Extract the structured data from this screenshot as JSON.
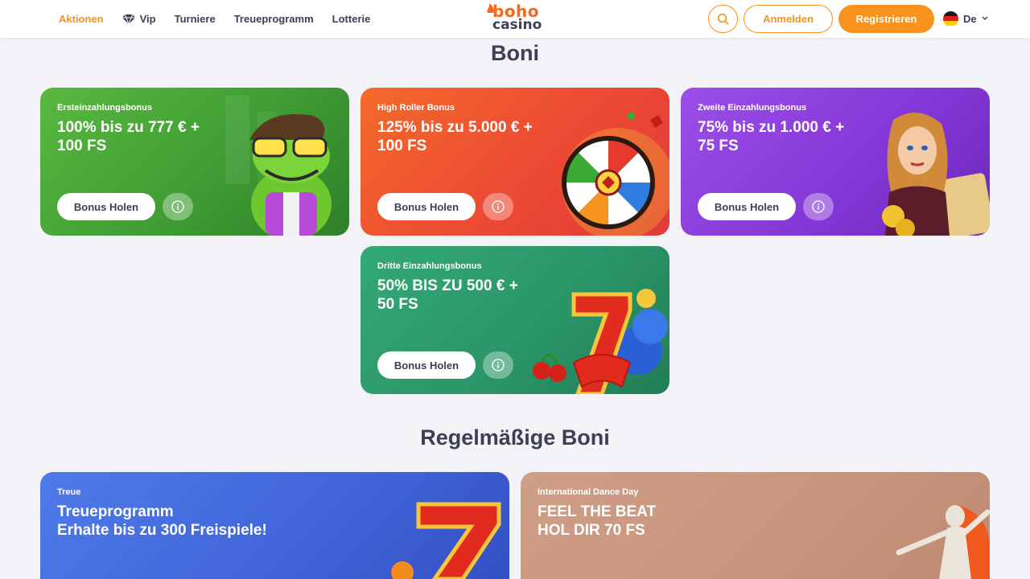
{
  "header": {
    "nav": [
      {
        "label": "Aktionen",
        "active": true
      },
      {
        "label": "Vip",
        "icon": "diamond-icon"
      },
      {
        "label": "Turniere"
      },
      {
        "label": "Treueprogramm"
      },
      {
        "label": "Lotterie"
      }
    ],
    "logo": {
      "top": "boho",
      "bottom": "casino"
    },
    "search_icon": "search-icon",
    "login_label": "Anmelden",
    "register_label": "Registrieren",
    "language": {
      "label": "De",
      "flag": "germany-flag-icon"
    }
  },
  "colors": {
    "accent": "#f7931e",
    "text_dark": "#3d3f55",
    "background": "#f3f2f7",
    "card_green": "#4da93a",
    "card_orange": "#ef5a2c",
    "card_purple": "#8b3fd9",
    "card_teal": "#2d9a6c",
    "card_blue": "#4f7ae8",
    "card_tan": "#c99881"
  },
  "sections": {
    "boni_title": "Boni",
    "regular_title": "Regelmäßige Boni"
  },
  "cards": [
    {
      "label": "Ersteinzahlungsbonus",
      "title_line1": "100% bis zu 777 € +",
      "title_line2": "100 FS",
      "button": "Bonus Holen",
      "icon": "info-icon"
    },
    {
      "label": "High Roller Bonus",
      "title_line1": "125% bis zu 5.000 € +",
      "title_line2": "100 FS",
      "button": "Bonus Holen",
      "icon": "info-icon"
    },
    {
      "label": "Zweite Einzahlungsbonus",
      "title_line1": "75% bis zu 1.000 € +",
      "title_line2": "75 FS",
      "button": "Bonus Holen",
      "icon": "info-icon"
    },
    {
      "label": "Dritte Einzahlungsbonus",
      "title_line1": "50% BIS ZU 500 € +",
      "title_line2": "50 FS",
      "button": "Bonus Holen",
      "icon": "info-icon"
    }
  ],
  "regular_cards": [
    {
      "label": "Treue",
      "title_line1": "Treueprogramm",
      "title_line2": "Erhalte bis zu 300 Freispiele!"
    },
    {
      "label": "International Dance Day",
      "title_line1": "FEEL THE BEAT",
      "title_line2": "HOL DIR 70 FS"
    }
  ]
}
